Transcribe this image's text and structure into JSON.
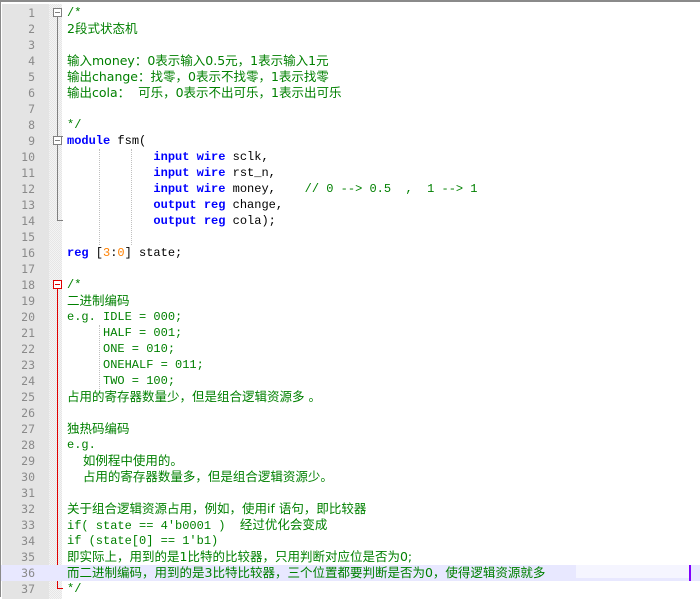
{
  "editor": {
    "language": "verilog",
    "lines": [
      {
        "n": "1",
        "segments": [
          {
            "t": "/*",
            "c": "cm"
          }
        ]
      },
      {
        "n": "2",
        "segments": [
          {
            "t": "2段式状态机",
            "c": "cn"
          }
        ]
      },
      {
        "n": "3",
        "segments": []
      },
      {
        "n": "4",
        "segments": [
          {
            "t": "输入money：0表示输入0.5元，1表示输入1元",
            "c": "cn"
          }
        ]
      },
      {
        "n": "5",
        "segments": [
          {
            "t": "输出change：找零，0表示不找零，1表示找零",
            "c": "cn"
          }
        ]
      },
      {
        "n": "6",
        "segments": [
          {
            "t": "输出cola：  可乐，0表示不出可乐，1表示出可乐",
            "c": "cn"
          }
        ]
      },
      {
        "n": "7",
        "segments": []
      },
      {
        "n": "8",
        "segments": [
          {
            "t": "*/",
            "c": "cm"
          }
        ]
      },
      {
        "n": "9",
        "segments": [
          {
            "t": "module",
            "c": "kw"
          },
          {
            "t": " fsm(",
            "c": ""
          }
        ]
      },
      {
        "n": "10",
        "segments": [
          {
            "t": "            ",
            "c": ""
          },
          {
            "t": "input",
            "c": "kw"
          },
          {
            "t": " ",
            "c": ""
          },
          {
            "t": "wire",
            "c": "kw"
          },
          {
            "t": " sclk,",
            "c": ""
          }
        ]
      },
      {
        "n": "11",
        "segments": [
          {
            "t": "            ",
            "c": ""
          },
          {
            "t": "input",
            "c": "kw"
          },
          {
            "t": " ",
            "c": ""
          },
          {
            "t": "wire",
            "c": "kw"
          },
          {
            "t": " rst_n,",
            "c": ""
          }
        ]
      },
      {
        "n": "12",
        "segments": [
          {
            "t": "            ",
            "c": ""
          },
          {
            "t": "input",
            "c": "kw"
          },
          {
            "t": " ",
            "c": ""
          },
          {
            "t": "wire",
            "c": "kw"
          },
          {
            "t": " money,    ",
            "c": ""
          },
          {
            "t": "// 0 --> 0.5  ,  1 --> 1",
            "c": "cm"
          }
        ]
      },
      {
        "n": "13",
        "segments": [
          {
            "t": "            ",
            "c": ""
          },
          {
            "t": "output",
            "c": "kw"
          },
          {
            "t": " ",
            "c": ""
          },
          {
            "t": "reg",
            "c": "kw"
          },
          {
            "t": " change,",
            "c": ""
          }
        ]
      },
      {
        "n": "14",
        "segments": [
          {
            "t": "            ",
            "c": ""
          },
          {
            "t": "output",
            "c": "kw"
          },
          {
            "t": " ",
            "c": ""
          },
          {
            "t": "reg",
            "c": "kw"
          },
          {
            "t": " cola);",
            "c": ""
          }
        ]
      },
      {
        "n": "15",
        "segments": []
      },
      {
        "n": "16",
        "segments": [
          {
            "t": "reg",
            "c": "kw"
          },
          {
            "t": " [",
            "c": ""
          },
          {
            "t": "3",
            "c": "num"
          },
          {
            "t": ":",
            "c": ""
          },
          {
            "t": "0",
            "c": "num"
          },
          {
            "t": "] state;",
            "c": ""
          }
        ]
      },
      {
        "n": "17",
        "segments": []
      },
      {
        "n": "18",
        "segments": [
          {
            "t": "/*",
            "c": "cm"
          }
        ]
      },
      {
        "n": "19",
        "segments": [
          {
            "t": "二进制编码",
            "c": "cn"
          }
        ]
      },
      {
        "n": "20",
        "segments": [
          {
            "t": "e.g. IDLE = 000;",
            "c": "cm"
          }
        ]
      },
      {
        "n": "21",
        "segments": [
          {
            "t": "     HALF = 001;",
            "c": "cm"
          }
        ]
      },
      {
        "n": "22",
        "segments": [
          {
            "t": "     ONE = 010;",
            "c": "cm"
          }
        ]
      },
      {
        "n": "23",
        "segments": [
          {
            "t": "     ONEHALF = 011;",
            "c": "cm"
          }
        ]
      },
      {
        "n": "24",
        "segments": [
          {
            "t": "     TWO = 100;",
            "c": "cm"
          }
        ]
      },
      {
        "n": "25",
        "segments": [
          {
            "t": "占用的寄存器数量少，但是组合逻辑资源多 。",
            "c": "cn"
          }
        ]
      },
      {
        "n": "26",
        "segments": []
      },
      {
        "n": "27",
        "segments": [
          {
            "t": "独热码编码",
            "c": "cn"
          }
        ]
      },
      {
        "n": "28",
        "segments": [
          {
            "t": "e.g.",
            "c": "cm"
          }
        ]
      },
      {
        "n": "29",
        "segments": [
          {
            "t": "    如例程中使用的。",
            "c": "cn"
          }
        ]
      },
      {
        "n": "30",
        "segments": [
          {
            "t": "    占用的寄存器数量多，但是组合逻辑资源少。",
            "c": "cn"
          }
        ]
      },
      {
        "n": "31",
        "segments": []
      },
      {
        "n": "32",
        "segments": [
          {
            "t": "关于组合逻辑资源占用，例如，使用if 语句，即比较器",
            "c": "cn"
          }
        ]
      },
      {
        "n": "33",
        "segments": [
          {
            "t": "if( state == 4'b0001 )  ",
            "c": "cm"
          },
          {
            "t": "经过优化会变成",
            "c": "cn"
          }
        ]
      },
      {
        "n": "34",
        "segments": [
          {
            "t": "if (state[0] == 1'b1)",
            "c": "cm"
          }
        ]
      },
      {
        "n": "35",
        "segments": [
          {
            "t": "即实际上，用到的是1比特的比较器，只用判断对应位是否为0;",
            "c": "cn"
          }
        ]
      },
      {
        "n": "36",
        "segments": [
          {
            "t": "而二进制编码，用到的是3比特比较器，三个位置都要判断是否为0，使得逻辑资源就多",
            "c": "cn"
          }
        ],
        "highlighted": true
      },
      {
        "n": "37",
        "segments": [
          {
            "t": "*/",
            "c": "cm"
          }
        ]
      }
    ]
  },
  "icons": {
    "fold": "fold-minus-icon"
  },
  "colors": {
    "comment": "#008000",
    "keyword": "#0000ff",
    "number": "#ff8000",
    "fold_active": "#e00000",
    "caret": "#8000ff",
    "current_line": "#e8e8ff"
  }
}
